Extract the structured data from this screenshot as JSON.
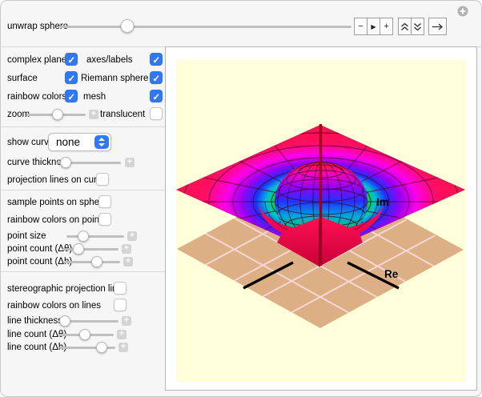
{
  "window": {
    "dismiss_icon": "plus-circle-icon"
  },
  "topbar": {
    "slider_label": "unwrap sphere",
    "slider_pos": "23%",
    "buttons": {
      "minus": "−",
      "play": "▶",
      "plus": "+",
      "faster_icon": "double-chevron-up-icon",
      "slower_icon": "double-chevron-down-icon",
      "step_icon": "arrow-right-icon"
    }
  },
  "ui": {
    "stepper_plus": "+"
  },
  "sidebar": {
    "section1": {
      "rows": [
        {
          "left_label": "complex plane",
          "left_checked": true,
          "right_label": "axes/labels",
          "right_checked": true
        },
        {
          "left_label": "surface",
          "left_checked": true,
          "right_label": "Riemann sphere",
          "right_checked": true
        },
        {
          "left_label": "rainbow colors",
          "left_checked": true,
          "right_label": "mesh",
          "right_checked": true
        }
      ],
      "zoom": {
        "label": "zoom",
        "pos": "53%"
      },
      "translucent": {
        "label": "translucent",
        "checked": false
      }
    },
    "section2": {
      "show_curve": {
        "label": "show curve",
        "value": "none"
      },
      "curve_thickness": {
        "label": "curve thickness",
        "pos": "14%"
      },
      "projection_lines": {
        "label": "projection lines on curve",
        "checked": false
      }
    },
    "section3": {
      "sample_points": {
        "label": "sample points on sphere",
        "checked": false
      },
      "rainbow_points": {
        "label": "rainbow colors on points",
        "checked": false
      },
      "point_size": {
        "label": "point size",
        "pos": "29%"
      },
      "point_count_theta": {
        "label": "point count (Δθ)",
        "pos": "28%"
      },
      "point_count_h": {
        "label": "point count (Δh)",
        "pos": "58%"
      }
    },
    "section4": {
      "stereo_lines": {
        "label": "stereographic projection lines",
        "checked": false
      },
      "rainbow_lines": {
        "label": "rainbow colors on lines",
        "checked": false
      },
      "line_thickness": {
        "label": "line thickness",
        "pos": "9%"
      },
      "line_count_theta": {
        "label": "line count (Δθ)",
        "pos": "49%"
      },
      "line_count_h": {
        "label": "line count (Δh)",
        "pos": "76%"
      }
    }
  },
  "plot": {
    "background_color": "#FFFEDB",
    "axis_labels": {
      "im": "Im",
      "re": "Re"
    },
    "plane_color": "#DCB084",
    "plane_grid_color": "#F6D6D6",
    "axis_line_color": "#000000",
    "vertical_axis_color": "#9C001E",
    "surface_height_colors": [
      "#00D83C",
      "#00C0D0",
      "#1A30FF",
      "#9E00F0",
      "#FF00E8",
      "#FF0E62",
      "#FA0D4E"
    ],
    "sphere_height_colors": [
      "#FF1A20",
      "#FF00B8",
      "#9A00F8",
      "#2430FF",
      "#00A8DC",
      "#00C85A"
    ]
  }
}
